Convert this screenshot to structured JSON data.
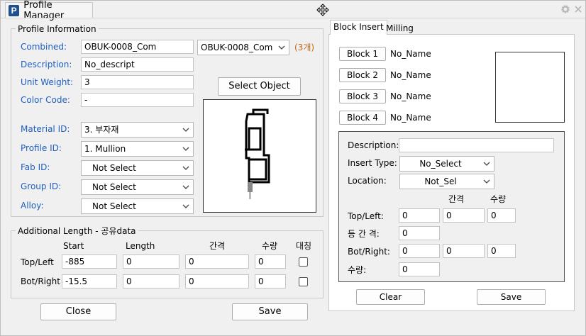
{
  "window": {
    "title": "Profile Manager",
    "icon_letter": "P",
    "icons": {
      "app": "app-logo-icon",
      "move": "move-cursor-icon",
      "settings": "gear-icon",
      "close": "close-icon"
    }
  },
  "profile_info": {
    "group_title": "Profile Information",
    "combined_label": "Combined:",
    "combined_value": "OBUK-0008_Com",
    "combined_select": "OBUK-0008_Com",
    "combined_count": "(3개)",
    "description_label": "Description:",
    "description_value": "No_descript",
    "unit_weight_label": "Unit Weight:",
    "unit_weight_value": "3",
    "color_code_label": "Color Code:",
    "color_code_value": "-",
    "select_object_label": "Select Object",
    "material_id_label": "Material ID:",
    "material_id_value": "3. 부자재",
    "profile_id_label": "Profile ID:",
    "profile_id_value": "1. Mullion",
    "fab_id_label": "Fab ID:",
    "fab_id_value": "Not Select",
    "group_id_label": "Group ID:",
    "group_id_value": "Not Select",
    "alloy_label": "Alloy:",
    "alloy_value": "Not Select"
  },
  "additional_length": {
    "group_title": "Additional Length - 공유data",
    "headers": {
      "start": "Start",
      "length": "Length",
      "gap": "간격",
      "qty": "수량",
      "mirror": "대칭"
    },
    "rows": [
      {
        "label": "Top/Left",
        "start": "-885",
        "length": "0",
        "gap": "0",
        "qty": "0",
        "mirror": false
      },
      {
        "label": "Bot/Right",
        "start": "-15.5",
        "length": "0",
        "gap": "0",
        "qty": "0",
        "mirror": false
      }
    ]
  },
  "footer_left": {
    "close_label": "Close",
    "save_label": "Save"
  },
  "tabs": {
    "block_insert": "Block Insert",
    "milling": "Milling"
  },
  "blocks": [
    {
      "button": "Block 1",
      "name": "No_Name"
    },
    {
      "button": "Block 2",
      "name": "No_Name"
    },
    {
      "button": "Block 3",
      "name": "No_Name"
    },
    {
      "button": "Block 4",
      "name": "No_Name"
    }
  ],
  "insert_detail": {
    "description_label": "Description:",
    "description_value": "",
    "insert_type_label": "Insert Type:",
    "insert_type_value": "No_Select",
    "location_label": "Location:",
    "location_value": "Not_Sel",
    "gap_header": "간격",
    "qty_header": "수량",
    "top_left_label": "Top/Left:",
    "top_left_values": [
      "0",
      "0",
      "0"
    ],
    "equal_gap_label": "등 간 격:",
    "equal_gap_value": "0",
    "bot_right_label": "Bot/Right:",
    "bot_right_values": [
      "0",
      "0",
      "0"
    ],
    "qty_label": "수량:",
    "qty_value": "0"
  },
  "footer_right": {
    "clear_label": "Clear",
    "save_label": "Save"
  },
  "colors": {
    "label_blue": "#1f5fbf",
    "count_orange": "#c06a1a",
    "icon_blue": "#1f4f8f"
  }
}
